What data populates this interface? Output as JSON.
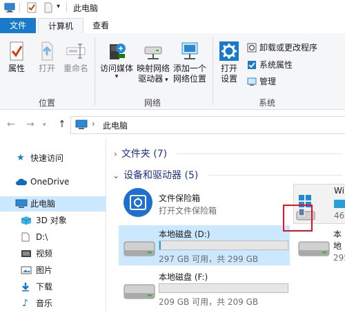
{
  "titlebar": {
    "title": "此电脑"
  },
  "tabs": {
    "file": "文件",
    "computer": "计算机",
    "view": "查看"
  },
  "ribbon": {
    "location": {
      "label": "位置",
      "properties": "属性",
      "open": "打开",
      "rename": "重命名"
    },
    "network": {
      "label": "网络",
      "access_media": "访问媒体",
      "map_drive_1": "映射网络",
      "map_drive_2": "驱动器",
      "add_location_1": "添加一个",
      "add_location_2": "网络位置"
    },
    "system": {
      "label": "系统",
      "open_settings_1": "打开",
      "open_settings_2": "设置",
      "uninstall": "卸载或更改程序",
      "sys_props": "系统属性",
      "manage": "管理"
    }
  },
  "address": {
    "path": "此电脑"
  },
  "nav": {
    "quick_access": "快速访问",
    "onedrive": "OneDrive",
    "this_pc": "此电脑",
    "objects3d": "3D 对象",
    "d_drive": "D:\\",
    "videos": "视频",
    "pictures": "图片",
    "downloads": "下载",
    "music": "音乐"
  },
  "content": {
    "folders_header": "文件夹 (7)",
    "devices_header": "设备和驱动器 (5)",
    "vault": {
      "name": "文件保险箱",
      "sub": "打开文件保险箱"
    },
    "drive_d": {
      "name": "本地磁盘 (D:)",
      "sub": "297 GB 可用，共 299 GB",
      "used_fraction": 0.01
    },
    "drive_f": {
      "name": "本地磁盘 (F:)",
      "sub": "209 GB 可用，共 209 GB",
      "used_fraction": 0.0
    },
    "drive_win": {
      "name": "Wi",
      "sub": "46."
    },
    "drive_right2": {
      "name": "本地",
      "sub": "295"
    }
  },
  "colors": {
    "accent": "#1979ca",
    "selection": "#cce8ff",
    "highlight_box": "#e81123",
    "bar_fill": "#26a0da"
  }
}
